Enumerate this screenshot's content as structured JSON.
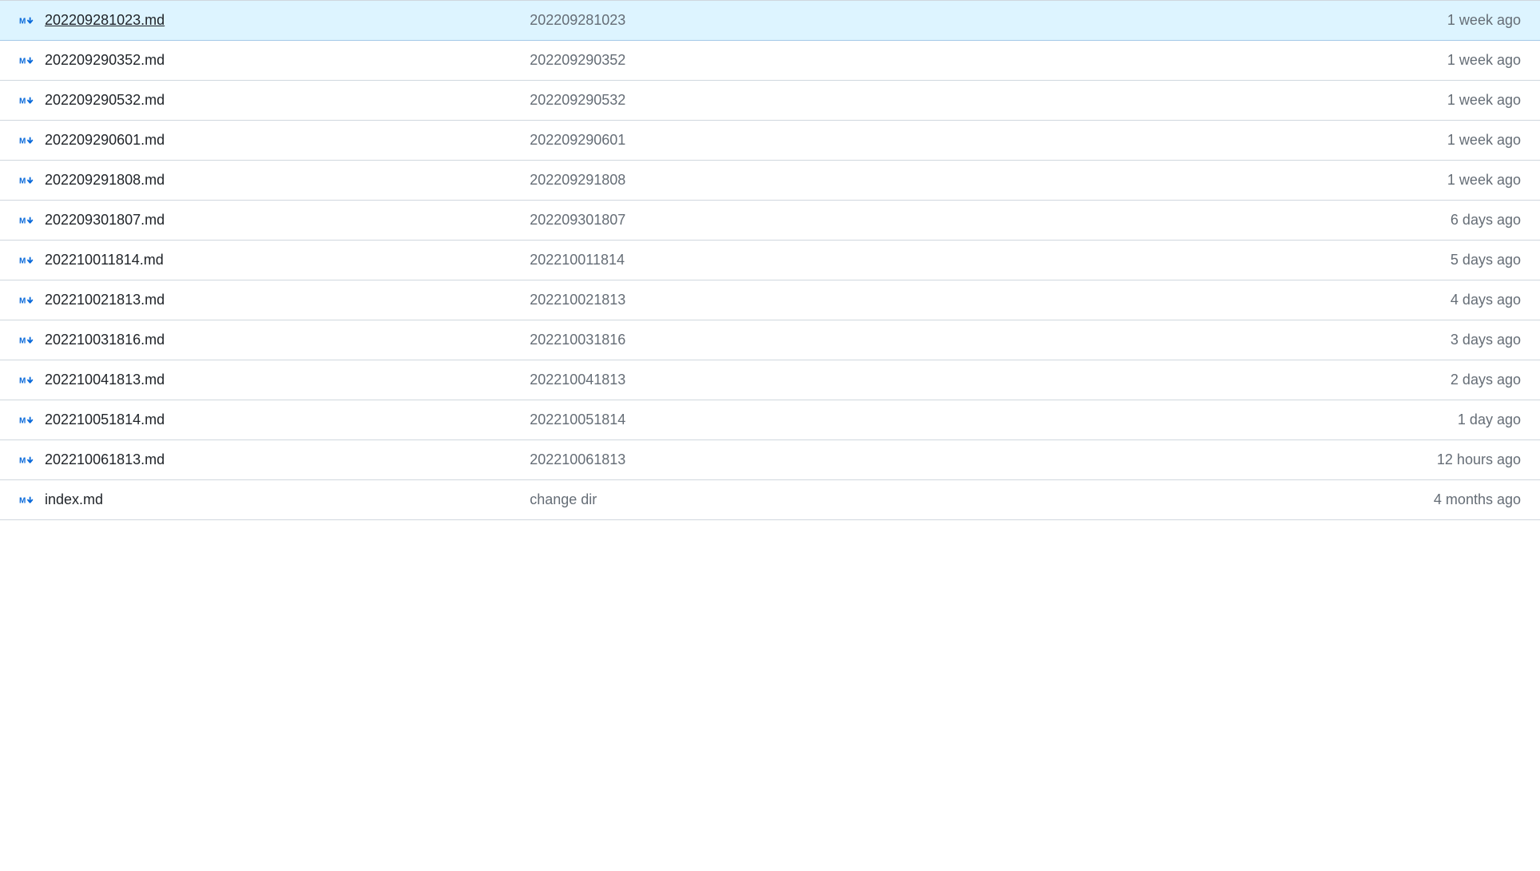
{
  "files": [
    {
      "name": "202209281023.md",
      "commit": "202209281023",
      "time": "1 week ago",
      "highlighted": true
    },
    {
      "name": "202209290352.md",
      "commit": "202209290352",
      "time": "1 week ago",
      "highlighted": false
    },
    {
      "name": "202209290532.md",
      "commit": "202209290532",
      "time": "1 week ago",
      "highlighted": false
    },
    {
      "name": "202209290601.md",
      "commit": "202209290601",
      "time": "1 week ago",
      "highlighted": false
    },
    {
      "name": "202209291808.md",
      "commit": "202209291808",
      "time": "1 week ago",
      "highlighted": false
    },
    {
      "name": "202209301807.md",
      "commit": "202209301807",
      "time": "6 days ago",
      "highlighted": false
    },
    {
      "name": "202210011814.md",
      "commit": "202210011814",
      "time": "5 days ago",
      "highlighted": false
    },
    {
      "name": "202210021813.md",
      "commit": "202210021813",
      "time": "4 days ago",
      "highlighted": false
    },
    {
      "name": "202210031816.md",
      "commit": "202210031816",
      "time": "3 days ago",
      "highlighted": false
    },
    {
      "name": "202210041813.md",
      "commit": "202210041813",
      "time": "2 days ago",
      "highlighted": false
    },
    {
      "name": "202210051814.md",
      "commit": "202210051814",
      "time": "1 day ago",
      "highlighted": false
    },
    {
      "name": "202210061813.md",
      "commit": "202210061813",
      "time": "12 hours ago",
      "highlighted": false
    },
    {
      "name": "index.md",
      "commit": "change dir",
      "time": "4 months ago",
      "highlighted": false
    }
  ],
  "icon_color": "#0969da"
}
